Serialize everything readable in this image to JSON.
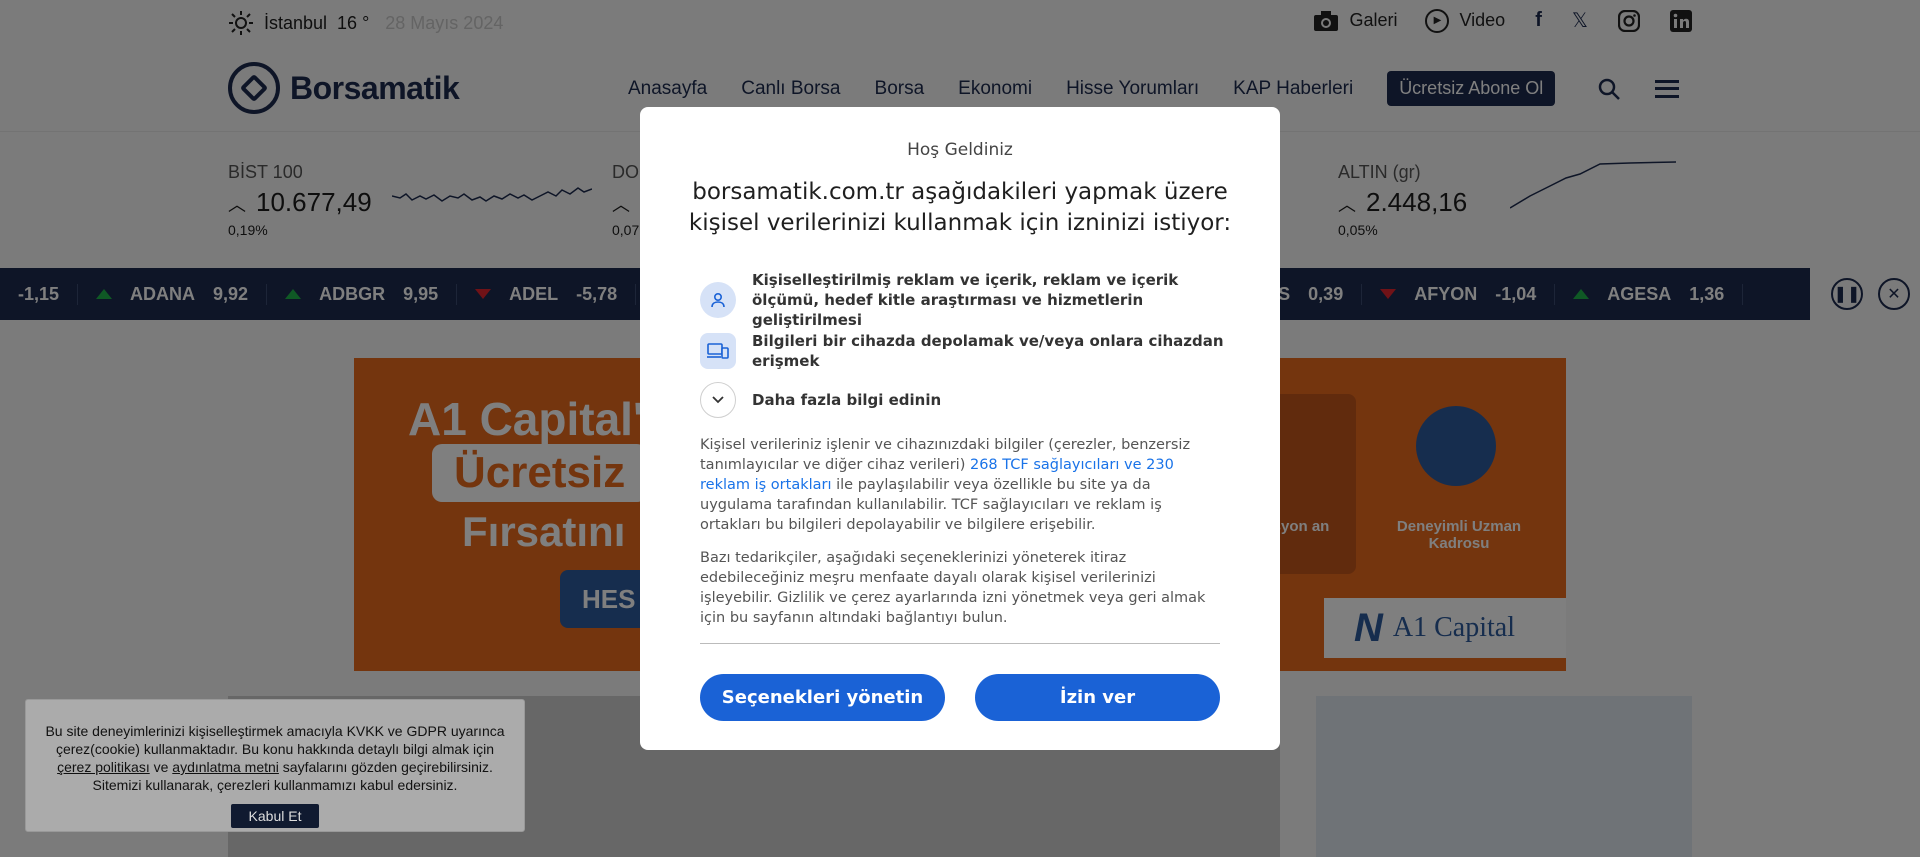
{
  "topbar": {
    "city": "İstanbul",
    "temp": "16 °",
    "date": "28 Mayıs 2024",
    "gallery": "Galeri",
    "video": "Video"
  },
  "header": {
    "logo": "Borsamatik",
    "nav": [
      "Anasayfa",
      "Canlı Borsa",
      "Borsa",
      "Ekonomi",
      "Hisse Yorumları",
      "KAP Haberleri"
    ],
    "cta": "Ücretsiz Abone Ol"
  },
  "markets": {
    "bist": {
      "name": "BİST 100",
      "value": "10.677,49",
      "pct": "0,19%"
    },
    "dolar": {
      "name": "DO",
      "pct": "0,07"
    },
    "altin": {
      "name": "ALTIN (gr)",
      "value": "2.448,16",
      "pct": "0,05%"
    }
  },
  "ticker": {
    "items": [
      {
        "sym": "",
        "val": "-1,15",
        "dir": "down"
      },
      {
        "sym": "ADANA",
        "val": "9,92",
        "dir": "up"
      },
      {
        "sym": "ADBGR",
        "val": "9,95",
        "dir": "up"
      },
      {
        "sym": "ADEL",
        "val": "-5,78",
        "dir": "down"
      },
      {
        "sym": "ES",
        "val": "0,39",
        "dir": "up"
      },
      {
        "sym": "AFYON",
        "val": "-1,04",
        "dir": "down"
      },
      {
        "sym": "AGESA",
        "val": "1,36",
        "dir": "up"
      }
    ]
  },
  "ad": {
    "line1": "A1 Capital'",
    "line2": "Ücretsiz",
    "line3": "Fırsatını",
    "button": "HES",
    "feature1": "omisyon an",
    "feature2": "Deneyimli Uzman Kadrosu",
    "brand": "A1 Capital",
    "brand_mark": "N"
  },
  "cookie": {
    "text1": "Bu site deneyimlerinizi kişiselleştirmek amacıyla KVKK ve GDPR uyarınca çerez(cookie) kullanmaktadır. Bu konu hakkında detaylı bilgi almak için",
    "link1": "çerez politikası",
    "and": "ve",
    "link2": "aydınlatma metni",
    "text2": "sayfalarını gözden geçirebilirsiniz. Sitemizi kullanarak, çerezleri kullanmamızı kabul edersiniz.",
    "accept": "Kabul Et"
  },
  "consent": {
    "welcome": "Hoş Geldiniz",
    "heading": "borsamatik.com.tr aşağıdakileri yapmak üzere kişisel verilerinizi kullanmak için izninizi istiyor:",
    "purpose1": "Kişiselleştirilmiş reklam ve içerik, reklam ve içerik ölçümü, hedef kitle araştırması ve hizmetlerin geliştirilmesi",
    "purpose2": "Bilgileri bir cihazda depolamak ve/veya onlara cihazdan erişmek",
    "more": "Daha fazla bilgi edinin",
    "para1_a": "Kişisel verileriniz işlenir ve cihazınızdaki bilgiler (çerezler, benzersiz tanımlayıcılar ve diğer cihaz verileri)",
    "para1_link": "268 TCF sağlayıcıları ve 230 reklam iş ortakları",
    "para1_b": "ile paylaşılabilir veya özellikle bu site ya da uygulama tarafından kullanılabilir. TCF sağlayıcıları ve reklam iş ortakları bu bilgileri depolayabilir ve bilgilere erişebilir.",
    "para2": "Bazı tedarikçiler, aşağıdaki seçeneklerinizi yöneterek itiraz edebileceğiniz meşru menfaate dayalı olarak kişisel verilerinizi işleyebilir. Gizlilik ve çerez ayarlarında izni yönetmek veya geri almak için bu sayfanın altındaki bağlantıyı bulun.",
    "manage": "Seçenekleri yönetin",
    "allow": "İzin ver"
  },
  "colors": {
    "brand": "#1d2b4f",
    "consent_button": "#1a62d6",
    "ad_orange": "#e96a1d"
  }
}
